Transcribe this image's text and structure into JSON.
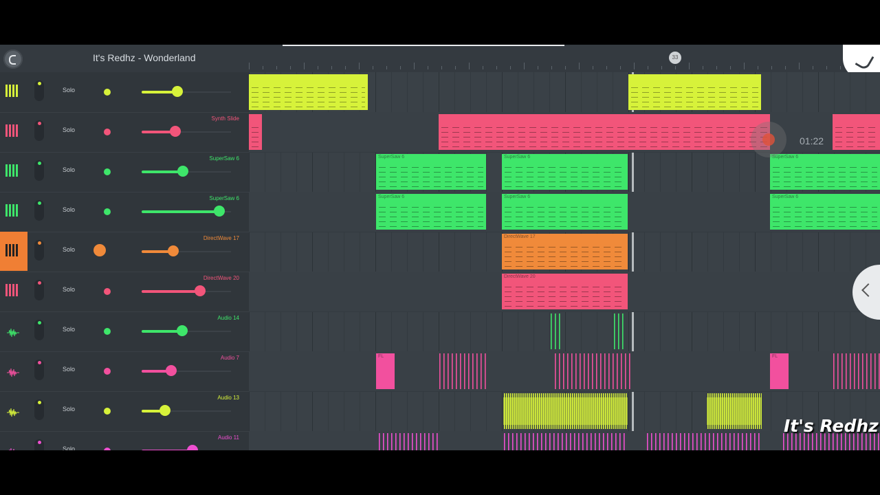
{
  "header": {
    "song_title": "It's Redhz - Wonderland",
    "bar_marker": "33"
  },
  "playback": {
    "time": "01:22"
  },
  "watermark": "It's Redhz",
  "solo_label": "Solo",
  "tracks": [
    {
      "name": "",
      "color": "#d7f23a",
      "icon": "piano-icon",
      "volume": 0.4,
      "selected": false
    },
    {
      "name": "Synth Slide",
      "color": "#f2557a",
      "icon": "piano-icon",
      "volume": 0.38,
      "selected": false
    },
    {
      "name": "SuperSaw 6",
      "color": "#3ee66a",
      "icon": "piano-icon",
      "volume": 0.46,
      "selected": false
    },
    {
      "name": "SuperSaw 6",
      "color": "#3ee66a",
      "icon": "piano-icon",
      "volume": 0.87,
      "selected": false
    },
    {
      "name": "DirectWave 17",
      "color": "#f08a3a",
      "icon": "piano-icon",
      "volume": 0.35,
      "selected": true
    },
    {
      "name": "DirectWave 20",
      "color": "#f2557a",
      "icon": "piano-icon",
      "volume": 0.65,
      "selected": false
    },
    {
      "name": "Audio 14",
      "color": "#3ee66a",
      "icon": "waveform-icon",
      "volume": 0.45,
      "selected": false
    },
    {
      "name": "Audio 7",
      "color": "#f2509e",
      "icon": "waveform-icon",
      "volume": 0.33,
      "selected": false
    },
    {
      "name": "Audio 13",
      "color": "#d7f23a",
      "icon": "waveform-icon",
      "volume": 0.26,
      "selected": false
    },
    {
      "name": "Audio 11",
      "color": "#ee4fd0",
      "icon": "waveform-icon",
      "volume": 0.57,
      "selected": false
    }
  ],
  "clips": [
    {
      "lane": 0,
      "start": 0,
      "len": 173,
      "kind": "pattern",
      "label": ""
    },
    {
      "lane": 0,
      "start": 552,
      "len": 193,
      "kind": "pattern",
      "label": ""
    },
    {
      "lane": 1,
      "start": 0,
      "len": 19,
      "kind": "pattern",
      "label": ""
    },
    {
      "lane": 1,
      "start": 276,
      "len": 482,
      "kind": "pattern",
      "label": ""
    },
    {
      "lane": 1,
      "start": 849,
      "len": 69,
      "kind": "pattern",
      "label": ""
    },
    {
      "lane": 2,
      "start": 185,
      "len": 160,
      "kind": "pattern",
      "label": "SuperSaw 6"
    },
    {
      "lane": 2,
      "start": 368,
      "len": 183,
      "kind": "pattern",
      "label": "SuperSaw 6"
    },
    {
      "lane": 2,
      "start": 758,
      "len": 160,
      "kind": "pattern",
      "label": "SuperSaw 6"
    },
    {
      "lane": 3,
      "start": 185,
      "len": 160,
      "kind": "pattern",
      "label": "SuperSaw 6"
    },
    {
      "lane": 3,
      "start": 368,
      "len": 183,
      "kind": "pattern",
      "label": "SuperSaw 6"
    },
    {
      "lane": 3,
      "start": 758,
      "len": 160,
      "kind": "pattern",
      "label": "SuperSaw 6"
    },
    {
      "lane": 4,
      "start": 368,
      "len": 183,
      "kind": "pattern",
      "label": "DirectWave 17"
    },
    {
      "lane": 5,
      "start": 368,
      "len": 183,
      "kind": "pattern",
      "label": "DirectWave 20"
    },
    {
      "lane": 6,
      "start": 438,
      "len": 18,
      "kind": "audio",
      "label": ""
    },
    {
      "lane": 6,
      "start": 530,
      "len": 16,
      "kind": "audio",
      "label": ""
    },
    {
      "lane": 7,
      "start": 185,
      "len": 27,
      "kind": "block",
      "label": "FL"
    },
    {
      "lane": 7,
      "start": 276,
      "len": 70,
      "kind": "audio",
      "label": ""
    },
    {
      "lane": 7,
      "start": 444,
      "len": 112,
      "kind": "audio",
      "label": ""
    },
    {
      "lane": 7,
      "start": 758,
      "len": 27,
      "kind": "block",
      "label": "FL"
    },
    {
      "lane": 7,
      "start": 849,
      "len": 69,
      "kind": "audio",
      "label": ""
    },
    {
      "lane": 8,
      "start": 370,
      "len": 181,
      "kind": "audio",
      "label": ""
    },
    {
      "lane": 8,
      "start": 666,
      "len": 80,
      "kind": "audio",
      "label": ""
    },
    {
      "lane": 9,
      "start": 188,
      "len": 88,
      "kind": "audio",
      "label": ""
    },
    {
      "lane": 9,
      "start": 370,
      "len": 181,
      "kind": "audio",
      "label": ""
    },
    {
      "lane": 9,
      "start": 578,
      "len": 168,
      "kind": "audio",
      "label": ""
    },
    {
      "lane": 9,
      "start": 776,
      "len": 142,
      "kind": "audio",
      "label": ""
    }
  ]
}
